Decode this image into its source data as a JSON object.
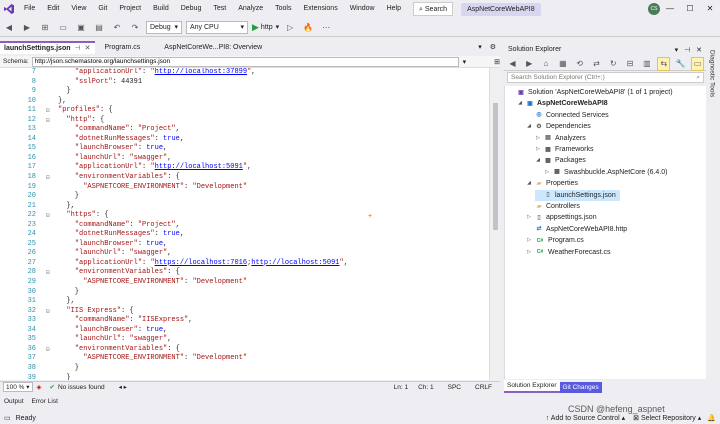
{
  "menubar": {
    "items": [
      "File",
      "Edit",
      "View",
      "Git",
      "Project",
      "Build",
      "Debug",
      "Test",
      "Analyze",
      "Tools",
      "Extensions",
      "Window",
      "Help"
    ],
    "search_label": "Search",
    "solution_title": "AspNetCoreWebAPI8",
    "avatar_initials": "CS"
  },
  "toolbar": {
    "config": "Debug",
    "platform": "Any CPU",
    "run_label": "http"
  },
  "tabs": [
    {
      "label": "launchSettings.json",
      "active": true
    },
    {
      "label": "Program.cs",
      "active": false
    },
    {
      "label": "AspNetCoreWe...PI8: Overview",
      "active": false
    }
  ],
  "schema": {
    "label": "Schema:",
    "value": "http://json.schemastore.org/launchsettings.json"
  },
  "code_lines": [
    {
      "n": "7",
      "t": "    \"applicationUrl\": \"http://localhost:37899\","
    },
    {
      "n": "8",
      "t": "    \"sslPort\": 44391"
    },
    {
      "n": "9",
      "t": "  }"
    },
    {
      "n": "10",
      "t": "},"
    },
    {
      "n": "11",
      "t": "\"profiles\": {"
    },
    {
      "n": "12",
      "t": "  \"http\": {"
    },
    {
      "n": "13",
      "t": "    \"commandName\": \"Project\","
    },
    {
      "n": "14",
      "t": "    \"dotnetRunMessages\": true,"
    },
    {
      "n": "15",
      "t": "    \"launchBrowser\": true,"
    },
    {
      "n": "16",
      "t": "    \"launchUrl\": \"swagger\","
    },
    {
      "n": "17",
      "t": "    \"applicationUrl\": \"http://localhost:5091\","
    },
    {
      "n": "18",
      "t": "    \"environmentVariables\": {"
    },
    {
      "n": "19",
      "t": "      \"ASPNETCORE_ENVIRONMENT\": \"Development\""
    },
    {
      "n": "20",
      "t": "    }"
    },
    {
      "n": "21",
      "t": "  },"
    },
    {
      "n": "22",
      "t": "  \"https\": {"
    },
    {
      "n": "23",
      "t": "    \"commandName\": \"Project\","
    },
    {
      "n": "24",
      "t": "    \"dotnetRunMessages\": true,"
    },
    {
      "n": "25",
      "t": "    \"launchBrowser\": true,"
    },
    {
      "n": "26",
      "t": "    \"launchUrl\": \"swagger\","
    },
    {
      "n": "27",
      "t": "    \"applicationUrl\": \"https://localhost:7016;http://localhost:5091\","
    },
    {
      "n": "28",
      "t": "    \"environmentVariables\": {"
    },
    {
      "n": "29",
      "t": "      \"ASPNETCORE_ENVIRONMENT\": \"Development\""
    },
    {
      "n": "30",
      "t": "    }"
    },
    {
      "n": "31",
      "t": "  },"
    },
    {
      "n": "32",
      "t": "  \"IIS Express\": {"
    },
    {
      "n": "33",
      "t": "    \"commandName\": \"IISExpress\","
    },
    {
      "n": "34",
      "t": "    \"launchBrowser\": true,"
    },
    {
      "n": "35",
      "t": "    \"launchUrl\": \"swagger\","
    },
    {
      "n": "36",
      "t": "    \"environmentVariables\": {"
    },
    {
      "n": "37",
      "t": "      \"ASPNETCORE_ENVIRONMENT\": \"Development\""
    },
    {
      "n": "38",
      "t": "    }"
    },
    {
      "n": "39",
      "t": "  }"
    }
  ],
  "editor_status": {
    "zoom": "100 %",
    "issues": "No issues found",
    "ln": "Ln: 1",
    "ch": "Ch: 1",
    "enc": "SPC",
    "eol": "CRLF"
  },
  "bottom_tabs": [
    "Output",
    "Error List"
  ],
  "app_status": {
    "ready": "Ready",
    "source_control": "Add to Source Control",
    "repo": "Select Repository",
    "watermark": "CSDN @hefeng_aspnet"
  },
  "solution_explorer": {
    "title": "Solution Explorer",
    "search_placeholder": "Search Solution Explorer (Ctrl+;)",
    "nodes": [
      {
        "label": "Solution 'AspNetCoreWebAPI8' (1 of 1 project)",
        "icon": "solution-icon"
      },
      {
        "label": "AspNetCoreWebAPI8",
        "icon": "project-icon",
        "bold": true
      },
      {
        "label": "Connected Services",
        "icon": "connected-services-icon"
      },
      {
        "label": "Dependencies",
        "icon": "dependencies-icon"
      },
      {
        "label": "Analyzers",
        "icon": "analyzers-icon"
      },
      {
        "label": "Frameworks",
        "icon": "frameworks-icon"
      },
      {
        "label": "Packages",
        "icon": "packages-icon"
      },
      {
        "label": "Swashbuckle.AspNetCore (6.4.0)",
        "icon": "package-icon"
      },
      {
        "label": "Properties",
        "icon": "folder-icon"
      },
      {
        "label": "launchSettings.json",
        "icon": "json-file-icon"
      },
      {
        "label": "Controllers",
        "icon": "folder-icon"
      },
      {
        "label": "appsettings.json",
        "icon": "json-file-icon"
      },
      {
        "label": "AspNetCoreWebAPI8.http",
        "icon": "http-file-icon"
      },
      {
        "label": "Program.cs",
        "icon": "csharp-file-icon"
      },
      {
        "label": "WeatherForecast.cs",
        "icon": "csharp-file-icon"
      }
    ],
    "bottom_tabs": [
      "Solution Explorer",
      "Git Changes"
    ]
  },
  "diagnostic_tools": "Diagnostic Tools"
}
